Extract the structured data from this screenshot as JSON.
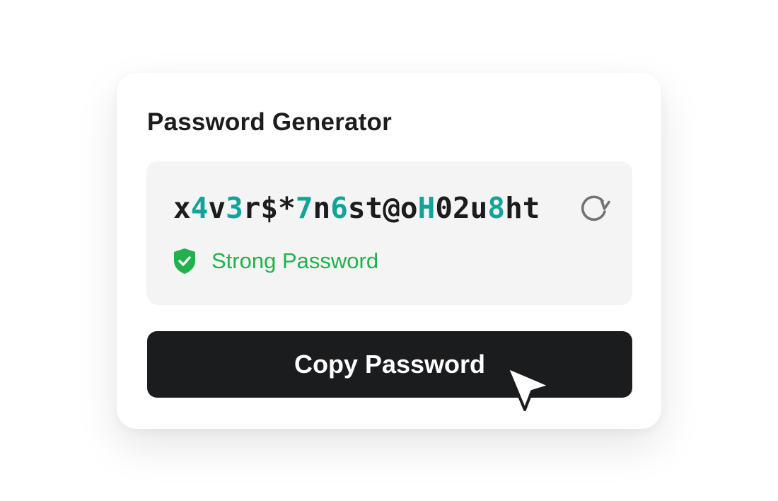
{
  "app": {
    "title": "Password Generator"
  },
  "password": {
    "segments": [
      {
        "text": "x",
        "digit": false
      },
      {
        "text": "4",
        "digit": true
      },
      {
        "text": "v",
        "digit": false
      },
      {
        "text": "3",
        "digit": true
      },
      {
        "text": "r$*",
        "digit": false
      },
      {
        "text": "7",
        "digit": true
      },
      {
        "text": "n",
        "digit": false
      },
      {
        "text": "6",
        "digit": true
      },
      {
        "text": "st@o",
        "digit": false
      },
      {
        "text": "H",
        "digit": true
      },
      {
        "text": "02u",
        "digit": false
      },
      {
        "text": "8",
        "digit": true
      },
      {
        "text": "ht",
        "digit": false
      }
    ],
    "refresh_icon": "refresh-icon"
  },
  "strength": {
    "label": "Strong Password",
    "icon": "shield-check-icon",
    "color": "#22b14c"
  },
  "actions": {
    "copy_label": "Copy Password"
  },
  "colors": {
    "accent_digit": "#14a39a",
    "button_bg": "#1b1c1e",
    "box_bg": "#f4f4f4",
    "success": "#22b14c"
  },
  "cursor_icon": "pointer-cursor-icon"
}
